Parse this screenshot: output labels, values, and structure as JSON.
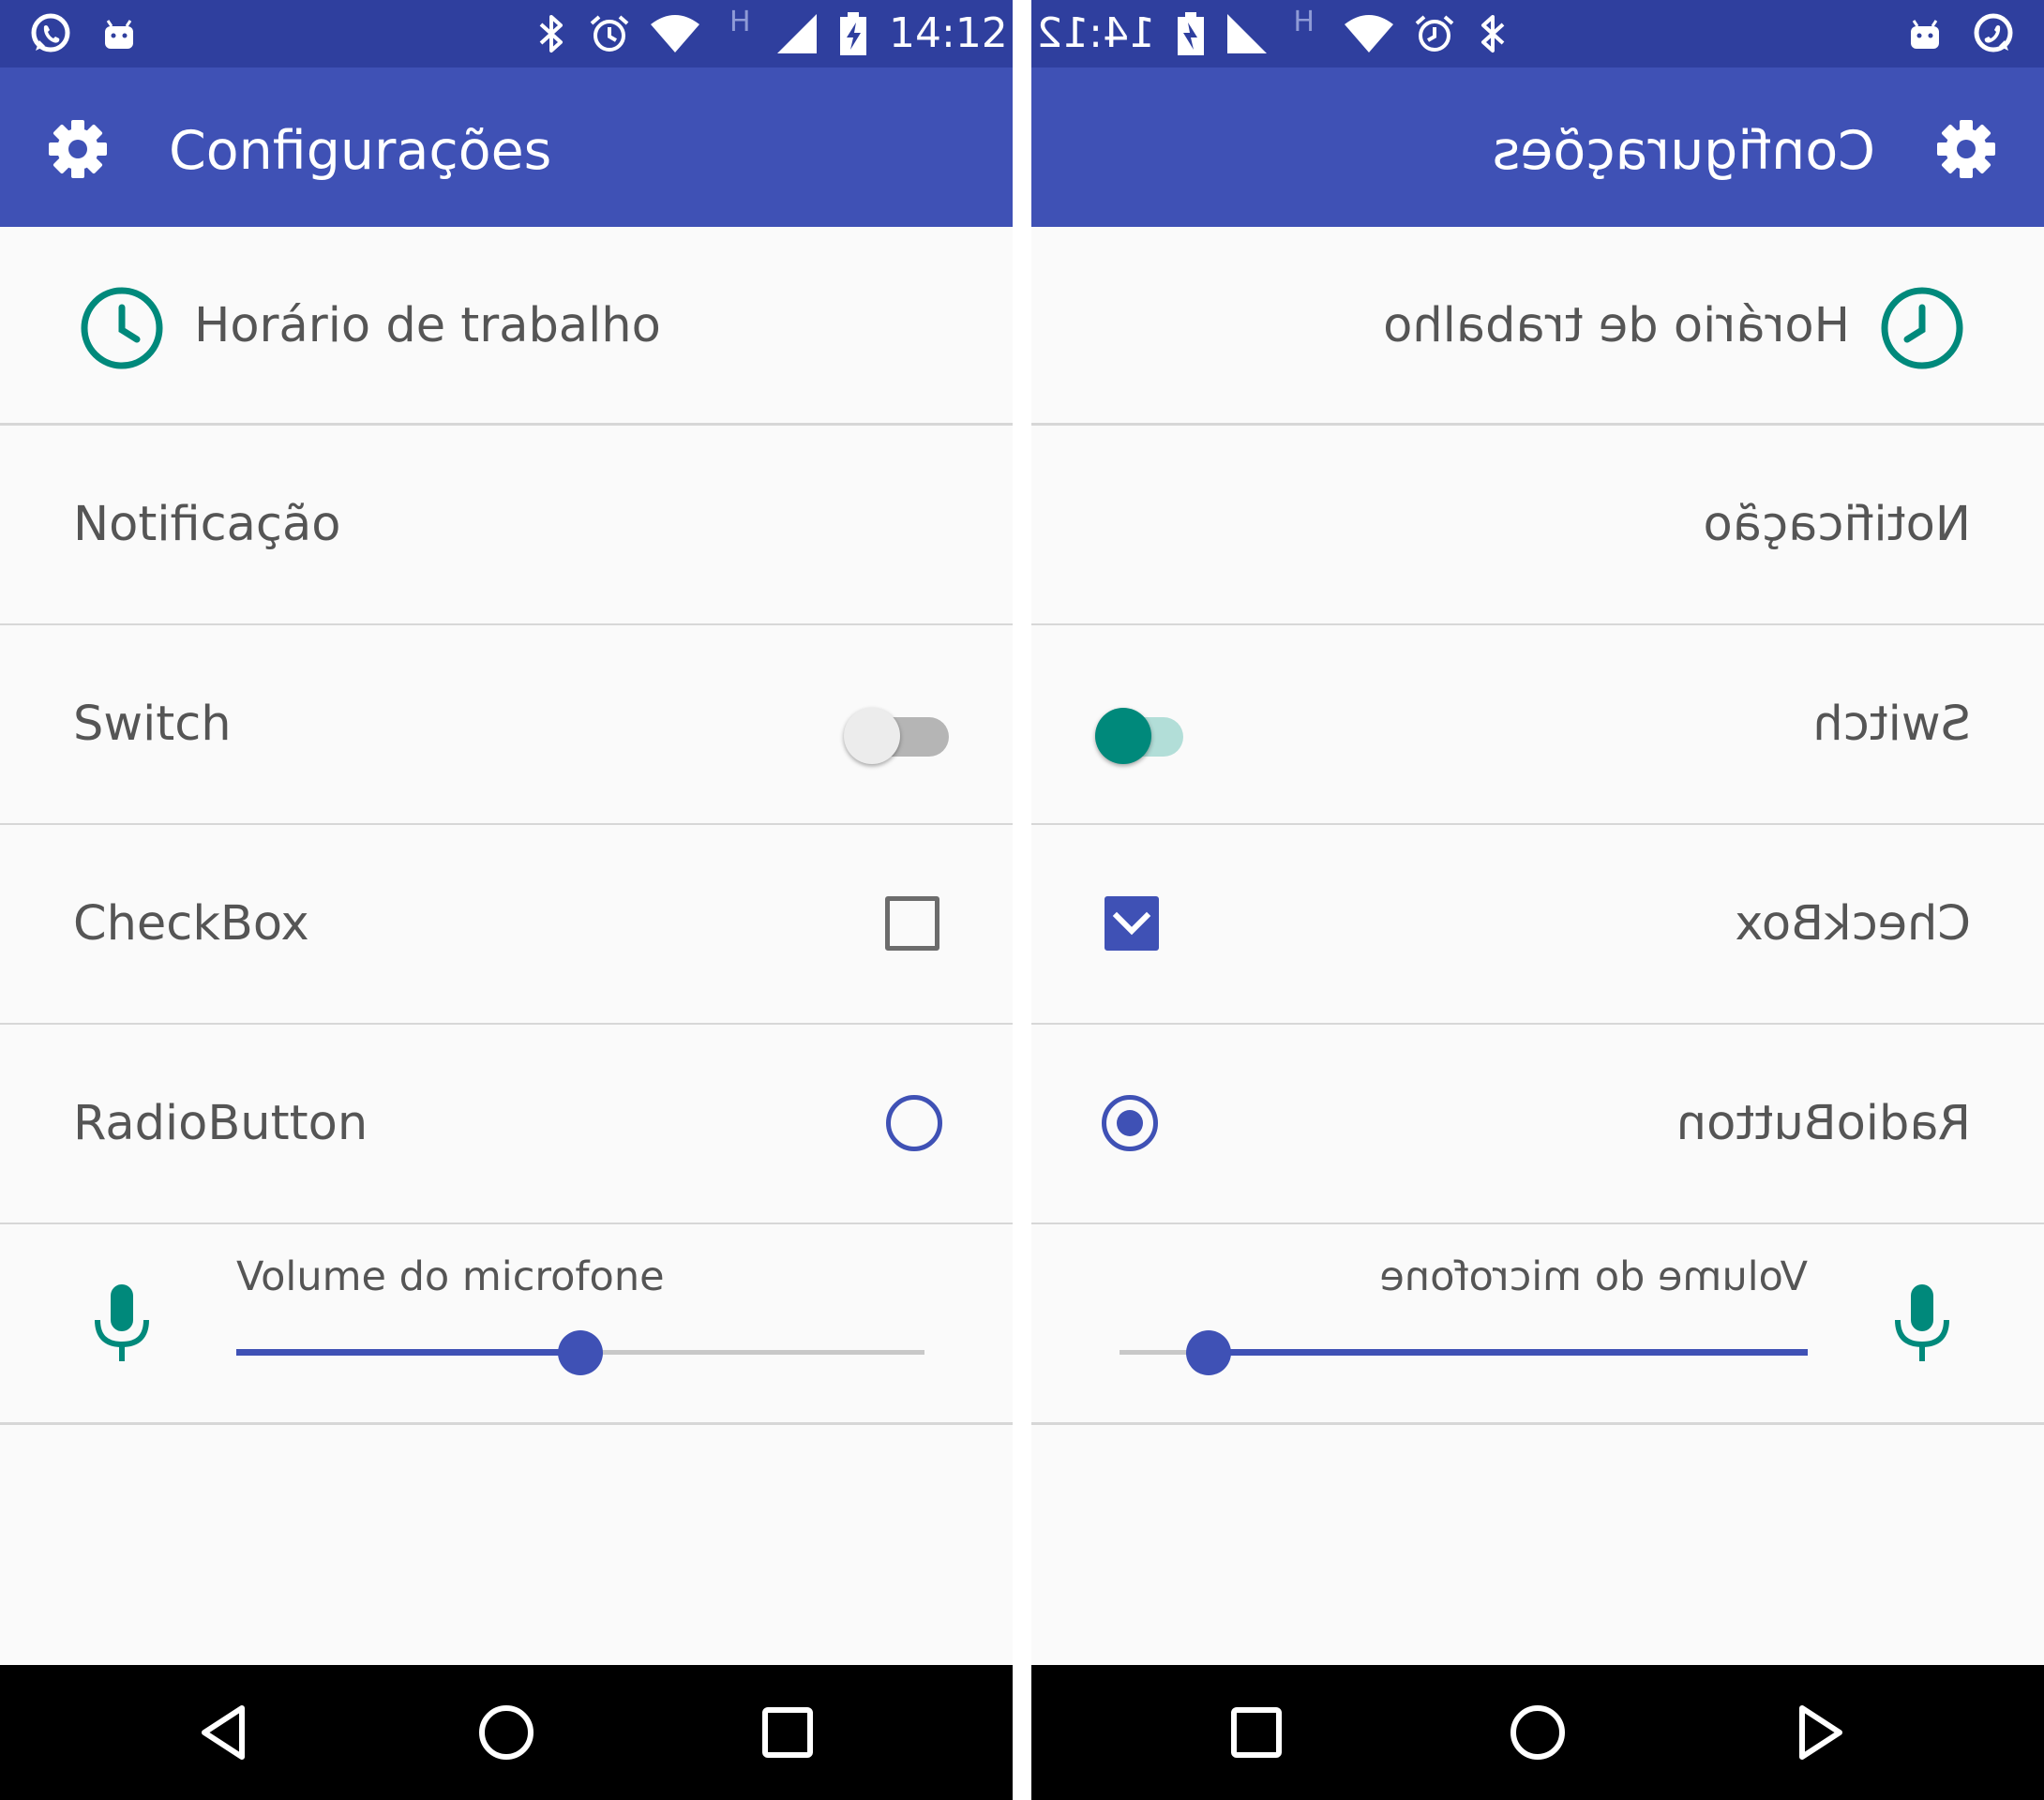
{
  "screens": {
    "left": {
      "status_time": "14:12",
      "network_letter": "H",
      "toolbar_title": "Configurações",
      "rows": {
        "work_hours": "Horário de trabalho",
        "notification": "Notificação",
        "switch": "Switch",
        "checkbox": "CheckBox",
        "radio": "RadioButton",
        "volume": "Volume do microfone"
      },
      "switch_on": false,
      "checkbox_checked": false,
      "radio_selected": false,
      "volume_level": 0.5
    },
    "right": {
      "status_time": "14:12",
      "network_letter": "H",
      "toolbar_title": "Configurações",
      "rows": {
        "work_hours": "Horário de trabalho",
        "notification": "Notificação",
        "switch": "Switch",
        "checkbox": "CheckBox",
        "radio": "RadioButton",
        "volume": "Volume do microfone"
      },
      "switch_on": true,
      "checkbox_checked": true,
      "radio_selected": true,
      "volume_level": 0.87,
      "layout_direction": "mirrored"
    }
  },
  "colors": {
    "status_bar": "#2f3f9e",
    "toolbar": "#3f51b5",
    "accent_teal": "#00897b",
    "accent_indigo": "#3f51b5",
    "nav_bar": "#000000"
  },
  "icons": {
    "status_left": [
      "whatsapp-icon",
      "android-icon"
    ],
    "status_right": [
      "bluetooth-icon",
      "alarm-icon",
      "wifi-icon",
      "cell-signal-icon",
      "battery-charging-icon"
    ],
    "toolbar": "gear-icon",
    "work_hours": "clock-icon",
    "volume": "microphone-icon",
    "nav": [
      "back-icon",
      "home-icon",
      "recents-icon"
    ]
  }
}
